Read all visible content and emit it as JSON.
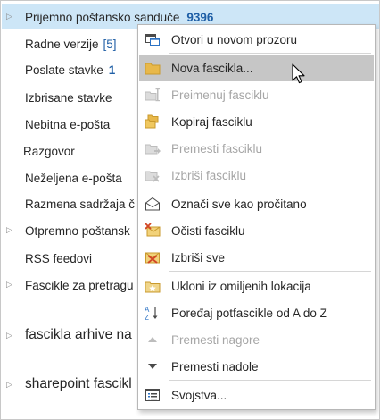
{
  "folders": [
    {
      "label": "Prijemno poštansko sanduče",
      "count": "9396",
      "expand": "▷",
      "selected": true
    },
    {
      "label": "Radne verzije",
      "count": "[5]"
    },
    {
      "label": "Poslate stavke",
      "count": "1"
    },
    {
      "label": "Izbrisane stavke"
    },
    {
      "label": "Nebitna e-pošta"
    },
    {
      "label": "Razgovor"
    },
    {
      "label": "Neželjena e-pošta"
    },
    {
      "label": "Razmena sadržaja č"
    },
    {
      "label": "Otpremno poštansk",
      "expand": "▷"
    },
    {
      "label": "RSS feedovi"
    },
    {
      "label": "Fascikle za pretragu",
      "expand": "▷"
    }
  ],
  "groups": [
    {
      "label": "fascikla arhive na",
      "expand": "▷"
    },
    {
      "label": "sharepoint fascikl",
      "expand": "▷"
    }
  ],
  "context_menu": {
    "items": [
      {
        "label": "Otvori u novom prozoru",
        "icon": "new-window-icon",
        "disabled": false
      },
      {
        "label": "Nova fascikla...",
        "icon": "new-folder-icon",
        "disabled": false,
        "hover": true
      },
      {
        "label": "Preimenuj fasciklu",
        "icon": "rename-folder-icon",
        "disabled": true
      },
      {
        "label": "Kopiraj fasciklu",
        "icon": "copy-folder-icon",
        "disabled": false
      },
      {
        "label": "Premesti fasciklu",
        "icon": "move-folder-icon",
        "disabled": true
      },
      {
        "label": "Izbriši fasciklu",
        "icon": "delete-folder-icon",
        "disabled": true
      },
      {
        "label": "Označi sve kao pročitano",
        "icon": "mark-read-icon",
        "disabled": false
      },
      {
        "label": "Očisti fasciklu",
        "icon": "clean-folder-icon",
        "disabled": false
      },
      {
        "label": "Izbriši sve",
        "icon": "delete-all-icon",
        "disabled": false
      },
      {
        "label": "Ukloni iz omiljenih lokacija",
        "icon": "favorite-remove-icon",
        "disabled": false
      },
      {
        "label": "Poređaj potfascikle od A do Z",
        "icon": "sort-az-icon",
        "disabled": false
      },
      {
        "label": "Premesti nagore",
        "icon": "move-up-icon",
        "disabled": true
      },
      {
        "label": "Premesti nadole",
        "icon": "move-down-icon",
        "disabled": false
      },
      {
        "label": "Svojstva...",
        "icon": "properties-icon",
        "disabled": false
      }
    ]
  },
  "colors": {
    "selection": "#cde6f7",
    "count": "#1f5fa6",
    "menu_hover": "#c6c6c6",
    "folder_yellow": "#e8b84a",
    "disabled_text": "#a6a6a6"
  }
}
